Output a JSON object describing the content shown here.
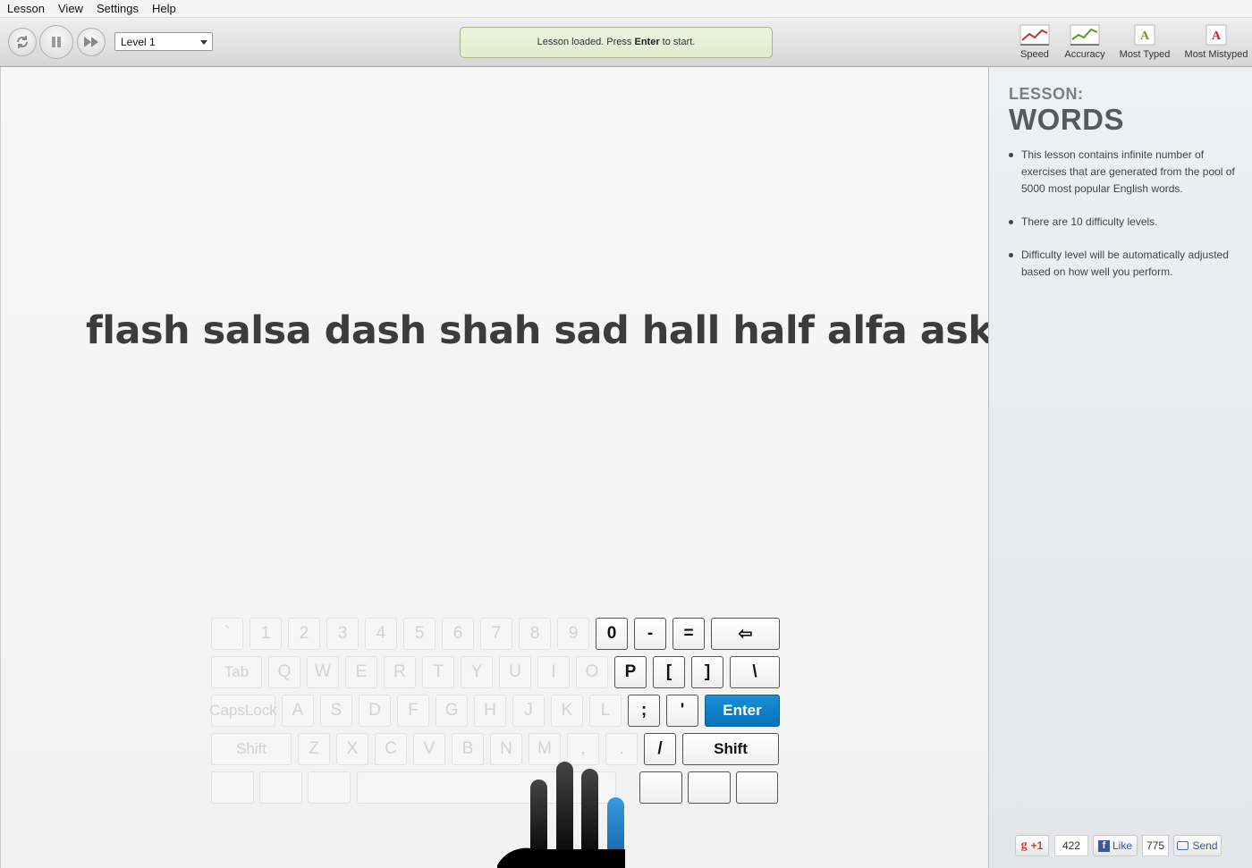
{
  "menu": {
    "items": [
      {
        "label": "Lesson"
      },
      {
        "label": "View"
      },
      {
        "label": "Settings"
      },
      {
        "label": "Help"
      }
    ]
  },
  "toolbar": {
    "level_value": "Level 1",
    "status_prefix": "Lesson loaded. Press ",
    "status_key": "Enter",
    "status_suffix": " to start.",
    "stats": [
      {
        "label": "Speed",
        "icon": "speed-chart-icon"
      },
      {
        "label": "Accuracy",
        "icon": "accuracy-chart-icon"
      },
      {
        "label": "Most Typed",
        "icon": "most-typed-letter-icon",
        "glyph": "A"
      },
      {
        "label": "Most Mistyped",
        "icon": "most-mistyped-letter-icon",
        "glyph": "A"
      }
    ],
    "accent_colors": {
      "speed_line": "#d0302a",
      "accuracy_line": "#5a9a20",
      "typed_letter": "#6a9a20",
      "mistyped_letter": "#cc2222",
      "enter_key": "#0a7fc7"
    }
  },
  "exercise": {
    "text": "flash salsa dash shah sad hall half alfa ask hash"
  },
  "keyboard": {
    "row1": [
      "`",
      "1",
      "2",
      "3",
      "4",
      "5",
      "6",
      "7",
      "8",
      "9",
      "0",
      "-",
      "=",
      "⇦"
    ],
    "row2": [
      "Tab",
      "Q",
      "W",
      "E",
      "R",
      "T",
      "Y",
      "U",
      "I",
      "O",
      "P",
      "[",
      "]",
      "\\"
    ],
    "row3": [
      "CapsLock",
      "A",
      "S",
      "D",
      "F",
      "G",
      "H",
      "J",
      "K",
      "L",
      ";",
      "'",
      "Enter"
    ],
    "row4": [
      "Shift",
      "Z",
      "X",
      "C",
      "V",
      "B",
      "N",
      "M",
      ",",
      ".",
      "/",
      "Shift"
    ],
    "active_keys": [
      "0",
      "-",
      "=",
      "⇦",
      "P",
      "[",
      "]",
      "\\",
      ";",
      "'",
      "Enter",
      "/",
      "Shift"
    ],
    "highlighted_finger": "right-pinky"
  },
  "lesson": {
    "label": "LESSON:",
    "title": "WORDS",
    "bullets": [
      "This lesson contains infinite number of exercises that are generated from the pool of 5000 most popular English words.",
      "There are 10 difficulty levels.",
      "Difficulty level will be automatically adjusted based on how well you perform."
    ]
  },
  "social": {
    "gplus_label": "+1",
    "gplus_count": "422",
    "like_label": "Like",
    "like_count": "775",
    "send_label": "Send"
  }
}
